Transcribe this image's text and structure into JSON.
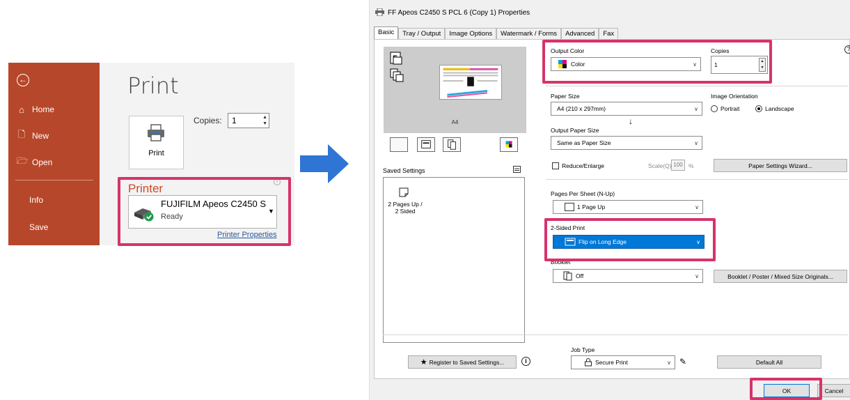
{
  "word": {
    "nav": {
      "back_icon": "arrow-left-circle",
      "home": "Home",
      "new": "New",
      "open": "Open",
      "info": "Info",
      "save": "Save"
    },
    "print_title": "Print",
    "copies_label": "Copies:",
    "copies_value": "1",
    "print_button": "Print",
    "printer_heading": "Printer",
    "printer_name": "FUJIFILM Apeos C2450 S",
    "printer_status": "Ready",
    "printer_properties_link": "Printer Properties",
    "colors": {
      "sidebar": "#b7472a",
      "accent": "#d24726",
      "highlight": "#d6336c"
    }
  },
  "dialog": {
    "title": "FF Apeos C2450 S PCL 6 (Copy 1) Properties",
    "tabs": [
      "Basic",
      "Tray / Output",
      "Image Options",
      "Watermark / Forms",
      "Advanced",
      "Fax"
    ],
    "preview_paper": "A4",
    "saved_settings_label": "Saved Settings",
    "saved_item": "2 Pages Up / 2 Sided",
    "output_color_label": "Output Color",
    "output_color_value": "Color",
    "copies_label": "Copies",
    "copies_value": "1",
    "paper_size_label": "Paper Size",
    "paper_size_value": "A4 (210 x 297mm)",
    "orientation_label": "Image Orientation",
    "portrait_label": "Portrait",
    "landscape_label": "Landscape",
    "orientation_selected": "Landscape",
    "output_paper_size_label": "Output Paper Size",
    "output_paper_size_value": "Same as Paper Size",
    "reduce_enlarge_label": "Reduce/Enlarge",
    "scale_label": "Scale(Q)",
    "scale_value": "100",
    "scale_unit": "%",
    "paper_wizard_button": "Paper Settings Wizard...",
    "pages_per_sheet_label": "Pages Per Sheet (N-Up)",
    "pages_per_sheet_value": "1 Page Up",
    "two_sided_label": "2-Sided Print",
    "two_sided_value": "Flip on Long Edge",
    "booklet_label": "Booklet",
    "booklet_value": "Off",
    "booklet_button": "Booklet / Poster / Mixed Size Originals...",
    "register_button": "Register to Saved Settings...",
    "job_type_label": "Job Type",
    "job_type_value": "Secure Print",
    "default_all_button": "Default All",
    "ok_button": "OK",
    "cancel_button": "Cancel",
    "selection_color": "#0078d7"
  }
}
